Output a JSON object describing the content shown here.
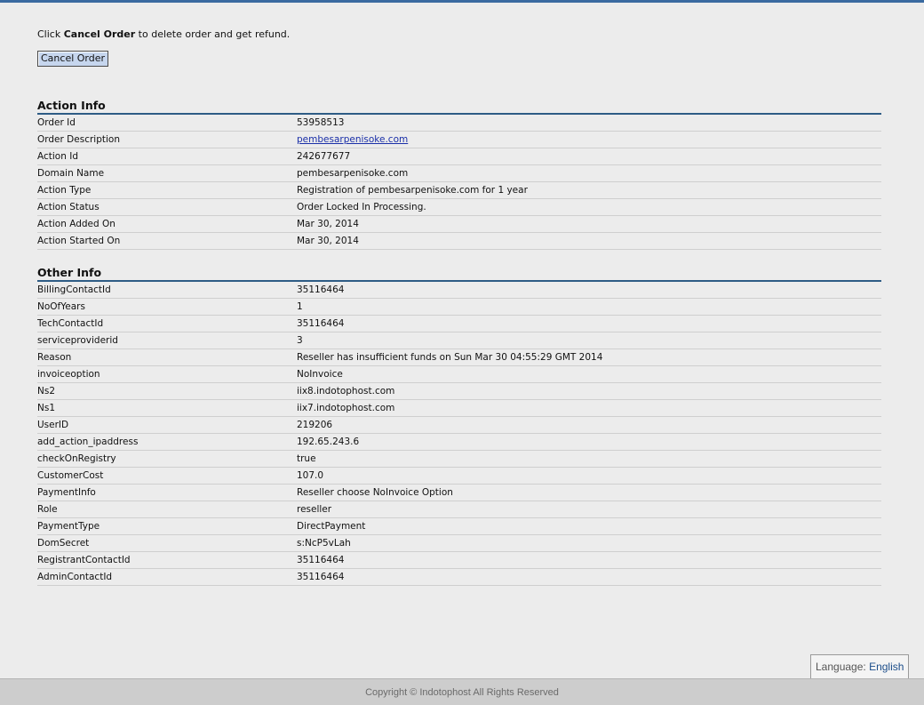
{
  "instruction": {
    "prefix": "Click ",
    "bold": "Cancel Order",
    "suffix": " to delete order and get refund."
  },
  "cancel_button_label": "Cancel Order",
  "action_info": {
    "title": "Action Info",
    "rows": [
      {
        "label": "Order Id",
        "value": "53958513"
      },
      {
        "label": "Order Description",
        "value": "pembesarpenisoke.com",
        "link": true
      },
      {
        "label": "Action Id",
        "value": "242677677"
      },
      {
        "label": "Domain Name",
        "value": "pembesarpenisoke.com"
      },
      {
        "label": "Action Type",
        "value": "Registration of pembesarpenisoke.com for 1 year"
      },
      {
        "label": "Action Status",
        "value": "Order Locked In Processing."
      },
      {
        "label": "Action Added On",
        "value": "Mar 30, 2014"
      },
      {
        "label": "Action Started On",
        "value": "Mar 30, 2014"
      }
    ]
  },
  "other_info": {
    "title": "Other Info",
    "rows": [
      {
        "label": "BillingContactId",
        "value": "35116464"
      },
      {
        "label": "NoOfYears",
        "value": "1"
      },
      {
        "label": "TechContactId",
        "value": "35116464"
      },
      {
        "label": "serviceproviderid",
        "value": "3"
      },
      {
        "label": "Reason",
        "value": "Reseller has insufficient funds on Sun Mar 30 04:55:29 GMT 2014"
      },
      {
        "label": "invoiceoption",
        "value": "NoInvoice"
      },
      {
        "label": "Ns2",
        "value": "iix8.indotophost.com"
      },
      {
        "label": "Ns1",
        "value": "iix7.indotophost.com"
      },
      {
        "label": "UserID",
        "value": "219206"
      },
      {
        "label": "add_action_ipaddress",
        "value": "192.65.243.6"
      },
      {
        "label": "checkOnRegistry",
        "value": "true"
      },
      {
        "label": "CustomerCost",
        "value": "107.0"
      },
      {
        "label": "PaymentInfo",
        "value": "Reseller choose NoInvoice Option"
      },
      {
        "label": "Role",
        "value": "reseller"
      },
      {
        "label": "PaymentType",
        "value": "DirectPayment"
      },
      {
        "label": "DomSecret",
        "value": "s:NcP5vLah"
      },
      {
        "label": "RegistrantContactId",
        "value": "35116464"
      },
      {
        "label": "AdminContactId",
        "value": "35116464"
      }
    ]
  },
  "language": {
    "label": "Language: ",
    "value": "English"
  },
  "footer": {
    "copyright": "Copyright © Indotophost All Rights Reserved"
  },
  "colors": {
    "accent": "#2e5c85",
    "link": "#1a2fa8",
    "button_bg": "#c6d6ee"
  }
}
